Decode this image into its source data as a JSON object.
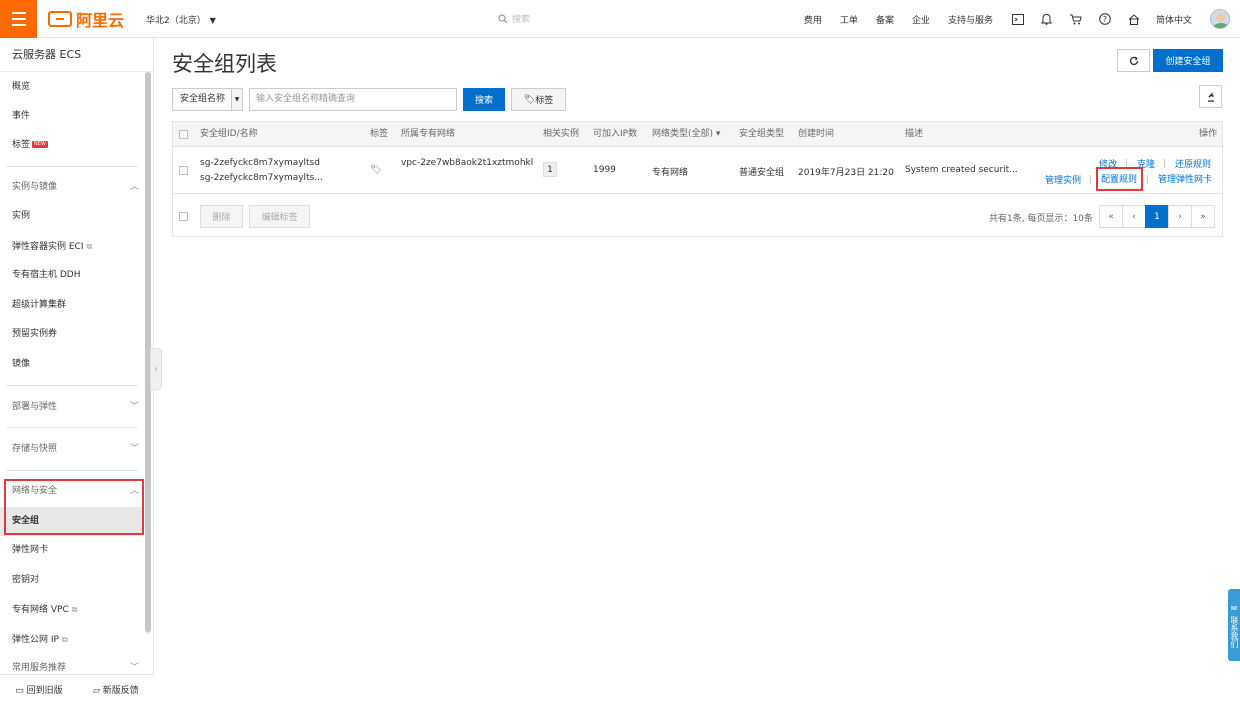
{
  "topbar": {
    "logo_text": "阿里云",
    "region": "华北2（北京）",
    "search_placeholder": "搜索",
    "nav": [
      "费用",
      "工单",
      "备案",
      "企业",
      "支持与服务"
    ],
    "language": "简体中文"
  },
  "sidebar": {
    "title": "云服务器 ECS",
    "items": {
      "overview": "概览",
      "events": "事件",
      "tags": "标签",
      "tags_badge": "NEW",
      "group_instances": "实例与镜像",
      "instances": "实例",
      "eci": "弹性容器实例 ECI",
      "ddh": "专有宿主机 DDH",
      "super_cluster": "超级计算集群",
      "reserved": "预留实例券",
      "images": "镜像",
      "group_deploy": "部署与弹性",
      "group_storage": "存储与快照",
      "group_network": "网络与安全",
      "security_group": "安全组",
      "eni": "弹性网卡",
      "keypair": "密钥对",
      "vpc": "专有网络 VPC",
      "eip": "弹性公网 IP",
      "common": "常用服务推荐"
    },
    "footer": {
      "old_version": "回到旧版",
      "feedback": "新版反馈"
    }
  },
  "main": {
    "title": "安全组列表",
    "create_button": "创建安全组",
    "filter_select": "安全组名称",
    "query_placeholder": "输入安全组名称精确查询",
    "search_button": "搜索",
    "tag_button": "标签",
    "table": {
      "headers": {
        "id_name": "安全组ID/名称",
        "tag": "标签",
        "vpc": "所属专有网络",
        "instances": "相关实例",
        "ip_count": "可加入IP数",
        "network_type": "网络类型(全部)",
        "sg_type": "安全组类型",
        "created": "创建时间",
        "desc": "描述",
        "actions": "操作"
      },
      "rows": [
        {
          "id": "sg-2zefyckc8m7xymayltsd",
          "name": "sg-2zefyckc8m7xymaylts...",
          "vpc": "vpc-2ze7wb8aok2t1xztmohkl",
          "instances": "1",
          "ip_count": "1999",
          "network_type": "专有网络",
          "sg_type": "普通安全组",
          "created": "2019年7月23日 21:20",
          "desc": "System created securit...",
          "actions": {
            "modify": "修改",
            "clone": "克隆",
            "restore": "还原规则",
            "manage_instances": "管理实例",
            "configure_rules": "配置规则",
            "manage_eni": "管理弹性网卡"
          }
        }
      ],
      "footer": {
        "delete": "删除",
        "edit_tags": "编辑标签",
        "summary": "共有1条, 每页显示：10条",
        "pages": [
          "«",
          "‹",
          "1",
          "›",
          "»"
        ],
        "current_page": "1"
      }
    }
  },
  "contact_tab": "联系我们",
  "colors": {
    "brand": "#ff6a00",
    "primary": "#0070cc",
    "highlight": "#e4393c"
  }
}
